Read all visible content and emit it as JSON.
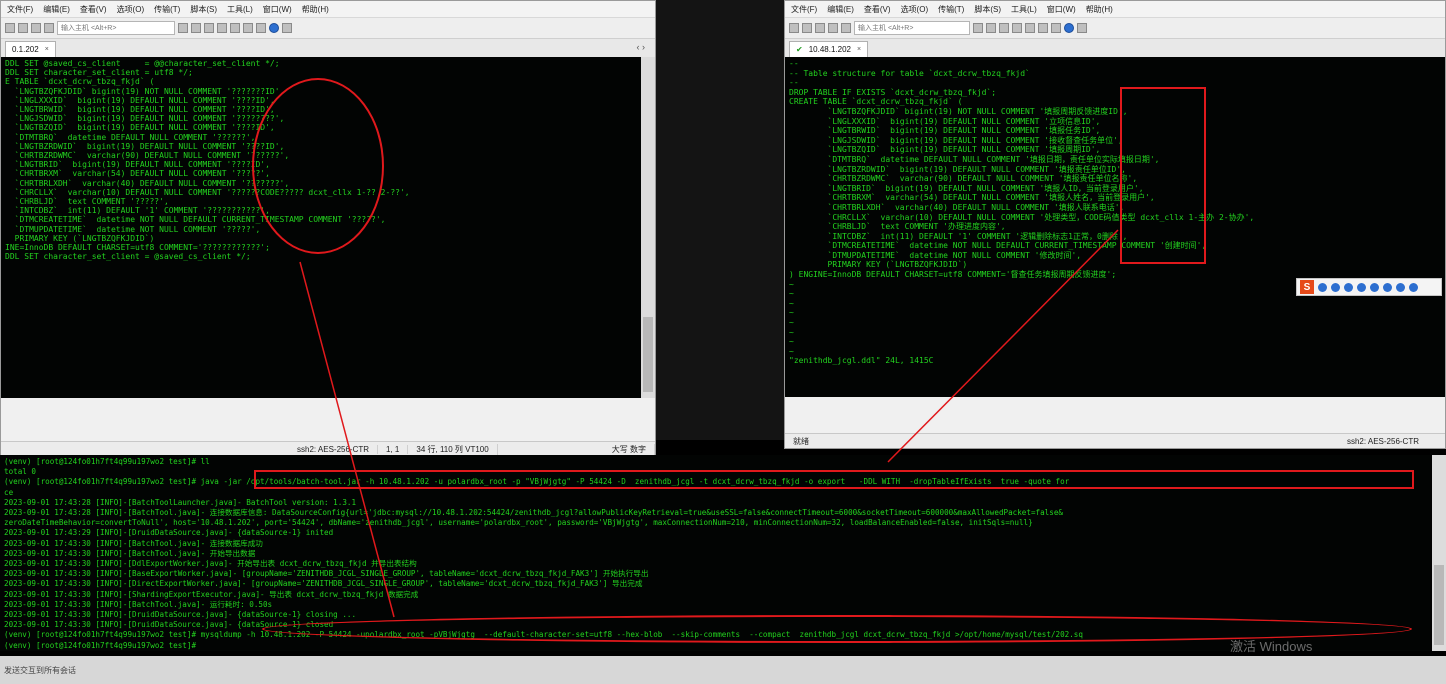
{
  "left_window": {
    "menu": [
      "文件(F)",
      "编辑(E)",
      "查看(V)",
      "选项(O)",
      "传输(T)",
      "脚本(S)",
      "工具(L)",
      "窗口(W)",
      "帮助(H)"
    ],
    "host_placeholder": "输入主机 <Alt+R>",
    "tab_label": "0.1.202",
    "tab_close": "×",
    "nav_arrows": "‹ ›",
    "terminal_lines": [
      "DDL SET @saved_cs_client     = @@character_set_client */;",
      "DDL SET character_set_client = utf8 */;",
      "E TABLE `dcxt_dcrw_tbzq_fkjd` (",
      "  `LNGTBZQFKJDID` bigint(19) NOT NULL COMMENT '???????ID',",
      "  `LNGLXXXID`  bigint(19) DEFAULT NULL COMMENT '????ID',",
      "  `LNGTBRWID`  bigint(19) DEFAULT NULL COMMENT '????ID',",
      "  `LNGJSDWID`  bigint(19) DEFAULT NULL COMMENT '????????',",
      "  `LNGTBZQID`  bigint(19) DEFAULT NULL COMMENT '????ID',",
      "  `DTMTBRQ`  datetime DEFAULT NULL COMMENT '??????',",
      "  `LNGTBZRDWID`  bigint(19) DEFAULT NULL COMMENT '????ID',",
      "  `CHRTBZRDWMC`  varchar(90) DEFAULT NULL COMMENT '??????',",
      "  `LNGTBRID`  bigint(19) DEFAULT NULL COMMENT '????ID',",
      "  `CHRTBRXM`  varchar(54) DEFAULT NULL COMMENT '?????',",
      "  `CHRTBRLXDH`  varchar(40) DEFAULT NULL COMMENT '???????',",
      "  `CHRCLLX`  varchar(10) DEFAULT NULL COMMENT '??????CODE????? dcxt_cllx 1-?? 2-??',",
      "  `CHRBLJD`  text COMMENT '?????',",
      "  `INTCDBZ`  int(11) DEFAULT '1' COMMENT '???????????',",
      "  `DTMCREATETIME`  datetime NOT NULL DEFAULT CURRENT_TIMESTAMP COMMENT '?????',",
      "  `DTMUPDATETIME`  datetime NOT NULL COMMENT '?????',",
      "  PRIMARY KEY (`LNGTBZQFKJDID`)",
      "INE=InnoDB DEFAULT CHARSET=utf8 COMMENT='????????????';",
      "DDL SET character_set_client = @saved_cs_client */;"
    ],
    "status": [
      "ssh2: AES-256-CTR",
      "1,  1",
      "34 行, 110 列 VT100",
      "大写  数字"
    ]
  },
  "right_window": {
    "menu": [
      "文件(F)",
      "编辑(E)",
      "查看(V)",
      "选项(O)",
      "传输(T)",
      "脚本(S)",
      "工具(L)",
      "窗口(W)",
      "帮助(H)"
    ],
    "host_placeholder": "输入主机 <Alt+R>",
    "tab_check": "✔",
    "tab_label": "10.48.1.202",
    "tab_close": "×",
    "terminal_lines": [
      "--",
      "-- Table structure for table `dcxt_dcrw_tbzq_fkjd`",
      "--",
      "DROP TABLE IF EXISTS `dcxt_dcrw_tbzq_fkjd`;",
      "CREATE TABLE `dcxt_dcrw_tbzq_fkjd` (",
      "        `LNGTBZQFKJDID` bigint(19) NOT NULL COMMENT '填报周期反馈进度ID',",
      "        `LNGLXXXID`  bigint(19) DEFAULT NULL COMMENT '立项信息ID',",
      "        `LNGTBRWID`  bigint(19) DEFAULT NULL COMMENT '填报任务ID',",
      "        `LNGJSDWID`  bigint(19) DEFAULT NULL COMMENT '接收督查任务单位',",
      "        `LNGTBZQID`  bigint(19) DEFAULT NULL COMMENT '填报周期ID',",
      "        `DTMTBRQ`  datetime DEFAULT NULL COMMENT '填报日期，责任单位实际填报日期',",
      "        `LNGTBZRDWID`  bigint(19) DEFAULT NULL COMMENT '填报责任单位ID',",
      "        `CHRTBZRDWMC`  varchar(90) DEFAULT NULL COMMENT '填报责任单位名称',",
      "        `LNGTBRID`  bigint(19) DEFAULT NULL COMMENT '填报人ID，当前登录用户',",
      "        `CHRTBRXM`  varchar(54) DEFAULT NULL COMMENT '填报人姓名，当前登录用户',",
      "        `CHRTBRLXDH`  varchar(40) DEFAULT NULL COMMENT '填报人联系电话',",
      "        `CHRCLLX`  varchar(10) DEFAULT NULL COMMENT '处理类型，CODE码值类型 dcxt_cllx 1-主办 2-协办',",
      "        `CHRBLJD`  text COMMENT '办理进度内容',",
      "        `INTCDBZ`  int(11) DEFAULT '1' COMMENT '逻辑删除标志1正常，0删除',",
      "        `DTMCREATETIME`  datetime NOT NULL DEFAULT CURRENT_TIMESTAMP COMMENT '创建时间',",
      "        `DTMUPDATETIME`  datetime NOT NULL COMMENT '修改时间',",
      "        PRIMARY KEY (`LNGTBZQFKJDID`)",
      ") ENGINE=InnoDB DEFAULT CHARSET=utf8 COMMENT='督查任务填报周期反馈进度';",
      "~",
      "~",
      "~",
      "~",
      "~",
      "~",
      "~",
      "~",
      "\"zenithdb_jcgl.ddl\" 24L, 1415C"
    ],
    "status_left": "就绪",
    "status_right": "ssh2: AES-256-CTR"
  },
  "bottom_terminal": {
    "lines": [
      "(venv) [root@124fo01h7ft4q99u197wo2 test]# ll",
      "total 0",
      "(venv) [root@124fo01h7ft4q99u197wo2 test]# java -jar /opt/tools/batch-tool.jar -h 10.48.1.202 -u polardbx_root -p \"VBjWjgtg\" -P 54424 -D  zenithdb_jcgl -t dcxt_dcrw_tbzq_fkjd -o export   -DDL WITH  -dropTableIfExists  true -quote for",
      "ce",
      "2023-09-01 17:43:28 [INFO]-[BatchToolLauncher.java]- BatchTool version: 1.3.1",
      "2023-09-01 17:43:28 [INFO]-[BatchTool.java]- 连接数据库信息: DataSourceConfig{url='jdbc:mysql://10.48.1.202:54424/zenithdb_jcgl?allowPublicKeyRetrieval=true&useSSL=false&connectTimeout=6000&socketTimeout=600000&maxAllowedPacket=false&",
      "zeroDateTimeBehavior=convertToNull', host='10.48.1.202', port='54424', dbName='zenithdb_jcgl', username='polardbx_root', password='VBjWjgtg', maxConnectionNum=210, minConnectionNum=32, loadBalanceEnabled=false, initSqls=null}",
      "2023-09-01 17:43:29 [INFO]-[DruidDataSource.java]- {dataSource-1} inited",
      "2023-09-01 17:43:30 [INFO]-[BatchTool.java]- 连接数据库成功",
      "2023-09-01 17:43:30 [INFO]-[BatchTool.java]- 开始导出数据",
      "2023-09-01 17:43:30 [INFO]-[DdlExportWorker.java]- 开始导出表 dcxt_dcrw_tbzq_fkjd 并导出表结构",
      "2023-09-01 17:43:30 [INFO]-[BaseExportWorker.java]- [groupName='ZENITHDB_JCGL_SINGLE_GROUP', tableName='dcxt_dcrw_tbzq_fkjd_FAK3'] 开始执行导出",
      "2023-09-01 17:43:30 [INFO]-[DirectExportWorker.java]- [groupName='ZENITHDB_JCGL_SINGLE_GROUP', tableName='dcxt_dcrw_tbzq_fkjd_FAK3'] 导出完成",
      "2023-09-01 17:43:30 [INFO]-[ShardingExportExecutor.java]- 导出表 dcxt_dcrw_tbzq_fkjd 数据完成",
      "2023-09-01 17:43:30 [INFO]-[BatchTool.java]- 运行耗时: 0.50s",
      "2023-09-01 17:43:30 [INFO]-[DruidDataSource.java]- {dataSource-1} closing ...",
      "2023-09-01 17:43:30 [INFO]-[DruidDataSource.java]- {dataSource-1} closed",
      "(venv) [root@124fo01h7ft4q99u197wo2 test]# mysqldump -h 10.48.1.202 -P 54424 -upolardbx_root -pVBjWjgtg  --default-character-set=utf8 --hex-blob  --skip-comments  --compact  zenithdb_jcgl dcxt_dcrw_tbzq_fkjd >/opt/home/mysql/test/202.sq",
      "(venv) [root@124fo01h7ft4q99u197wo2 test]# "
    ]
  },
  "bottom_bar": {
    "text": "发送交互到所有会话"
  },
  "watermark": "激活 Windows",
  "ime_logo": "S",
  "colors": {
    "terminal_green": "#23d21f",
    "highlight_red": "#e0191c",
    "terminal_bg": "#020403"
  }
}
